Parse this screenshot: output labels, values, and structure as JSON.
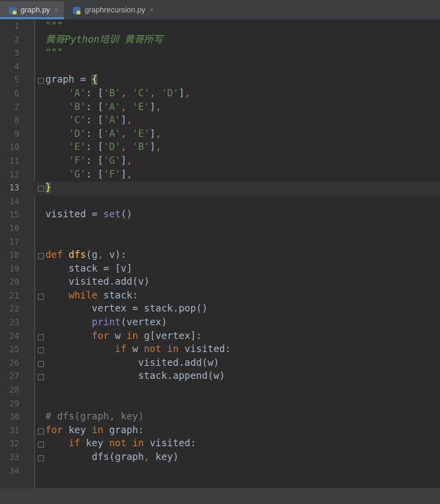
{
  "tabs": [
    {
      "label": "graph.py",
      "active": true,
      "icon": "python-file-icon"
    },
    {
      "label": "graphrecursion.py",
      "active": false,
      "icon": "python-file-icon"
    }
  ],
  "colors": {
    "background": "#2b2b2b",
    "gutter": "#313335",
    "keyword": "#cc7832",
    "string": "#6a8759",
    "docstring": "#629755",
    "function": "#ffc66d",
    "builtin": "#8888c6",
    "comment": "#808080",
    "text": "#a9b7c6"
  },
  "editor": {
    "current_line": 13,
    "lines": [
      {
        "n": "1",
        "text": "\"\"\""
      },
      {
        "n": "2",
        "text": "黄哥Python培训 黄哥所写"
      },
      {
        "n": "3",
        "text": "\"\"\""
      },
      {
        "n": "4",
        "text": ""
      },
      {
        "n": "5",
        "text": "graph = {"
      },
      {
        "n": "6",
        "text": "    'A': ['B', 'C', 'D'],"
      },
      {
        "n": "7",
        "text": "    'B': ['A', 'E'],"
      },
      {
        "n": "8",
        "text": "    'C': ['A'],"
      },
      {
        "n": "9",
        "text": "    'D': ['A', 'E'],"
      },
      {
        "n": "10",
        "text": "    'E': ['D', 'B'],"
      },
      {
        "n": "11",
        "text": "    'F': ['G'],"
      },
      {
        "n": "12",
        "text": "    'G': ['F'],"
      },
      {
        "n": "13",
        "text": "}"
      },
      {
        "n": "14",
        "text": ""
      },
      {
        "n": "15",
        "text": "visited = set()"
      },
      {
        "n": "16",
        "text": ""
      },
      {
        "n": "17",
        "text": ""
      },
      {
        "n": "18",
        "text": "def dfs(g, v):"
      },
      {
        "n": "19",
        "text": "    stack = [v]"
      },
      {
        "n": "20",
        "text": "    visited.add(v)"
      },
      {
        "n": "21",
        "text": "    while stack:"
      },
      {
        "n": "22",
        "text": "        vertex = stack.pop()"
      },
      {
        "n": "23",
        "text": "        print(vertex)"
      },
      {
        "n": "24",
        "text": "        for w in g[vertex]:"
      },
      {
        "n": "25",
        "text": "            if w not in visited:"
      },
      {
        "n": "26",
        "text": "                visited.add(w)"
      },
      {
        "n": "27",
        "text": "                stack.append(w)"
      },
      {
        "n": "28",
        "text": ""
      },
      {
        "n": "29",
        "text": ""
      },
      {
        "n": "30",
        "text": "# dfs(graph, key)"
      },
      {
        "n": "31",
        "text": "for key in graph:"
      },
      {
        "n": "32",
        "text": "    if key not in visited:"
      },
      {
        "n": "33",
        "text": "        dfs(graph, key)"
      },
      {
        "n": "34",
        "text": ""
      }
    ]
  }
}
